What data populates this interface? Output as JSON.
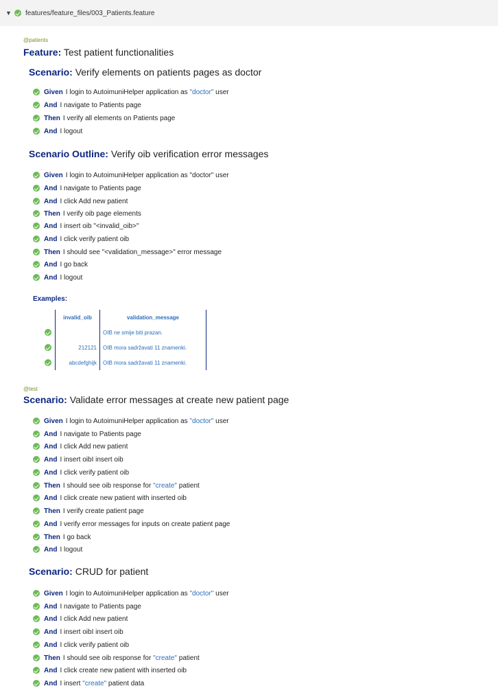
{
  "header": {
    "path": "features/feature_files/003_Patients.feature"
  },
  "feature": {
    "tag": "@patients",
    "keyword": "Feature:",
    "title": "Test patient functionalities"
  },
  "scenarios": [
    {
      "keyword": "Scenario:",
      "title": "Verify elements on patients pages as doctor",
      "steps": [
        {
          "kw": "Given",
          "pre": "I login to AutoimuniHelper application as ",
          "q": "\"doctor\"",
          "post": " user"
        },
        {
          "kw": "And",
          "pre": "I navigate to Patients page",
          "q": "",
          "post": ""
        },
        {
          "kw": "Then",
          "pre": "I verify all elements on Patients page",
          "q": "",
          "post": ""
        },
        {
          "kw": "And",
          "pre": "I logout",
          "q": "",
          "post": ""
        }
      ]
    },
    {
      "keyword": "Scenario Outline:",
      "title": "Verify oib verification error messages",
      "steps": [
        {
          "kw": "Given",
          "pre": "I login to AutoimuniHelper application as \"doctor\" user",
          "q": "",
          "post": ""
        },
        {
          "kw": "And",
          "pre": "I navigate to Patients page",
          "q": "",
          "post": ""
        },
        {
          "kw": "And",
          "pre": "I click Add new patient",
          "q": "",
          "post": ""
        },
        {
          "kw": "Then",
          "pre": "I verify oib page elements",
          "q": "",
          "post": ""
        },
        {
          "kw": "And",
          "pre": "I insert oib \"<invalid_oib>\"",
          "q": "",
          "post": ""
        },
        {
          "kw": "And",
          "pre": "I click verify patient oib",
          "q": "",
          "post": ""
        },
        {
          "kw": "Then",
          "pre": "I should see \"<validation_message>\" error message",
          "q": "",
          "post": ""
        },
        {
          "kw": "And",
          "pre": "I go back",
          "q": "",
          "post": ""
        },
        {
          "kw": "And",
          "pre": "I logout",
          "q": "",
          "post": ""
        }
      ],
      "examples": {
        "label": "Examples:",
        "headers": [
          "invalid_oib",
          "validation_message"
        ],
        "rows": [
          [
            "",
            "OIB ne smije biti prazan."
          ],
          [
            "212121",
            "OIB mora sadržavati 11 znamenki."
          ],
          [
            "abcdefghijk",
            "OIB mora sadržavati 11 znamenki."
          ]
        ]
      }
    },
    {
      "tag": "@test",
      "keyword": "Scenario:",
      "title": "Validate error messages at create new patient page",
      "steps": [
        {
          "kw": "Given",
          "pre": "I login to AutoimuniHelper application as ",
          "q": "\"doctor\"",
          "post": " user"
        },
        {
          "kw": "And",
          "pre": "I navigate to Patients page",
          "q": "",
          "post": ""
        },
        {
          "kw": "And",
          "pre": "I click Add new patient",
          "q": "",
          "post": ""
        },
        {
          "kw": "And",
          "pre": "I insert oibI insert oib",
          "q": "",
          "post": ""
        },
        {
          "kw": "And",
          "pre": "I click verify patient oib",
          "q": "",
          "post": ""
        },
        {
          "kw": "Then",
          "pre": "I should see oib response for ",
          "q": "\"create\"",
          "post": " patient"
        },
        {
          "kw": "And",
          "pre": "I click create new patient with inserted oib",
          "q": "",
          "post": ""
        },
        {
          "kw": "Then",
          "pre": "I verify create patient page",
          "q": "",
          "post": ""
        },
        {
          "kw": "And",
          "pre": "I verify error messages for inputs on create patient page",
          "q": "",
          "post": ""
        },
        {
          "kw": "Then",
          "pre": "I go back",
          "q": "",
          "post": ""
        },
        {
          "kw": "And",
          "pre": "I logout",
          "q": "",
          "post": ""
        }
      ]
    },
    {
      "keyword": "Scenario:",
      "title": "CRUD for patient",
      "steps": [
        {
          "kw": "Given",
          "pre": "I login to AutoimuniHelper application as ",
          "q": "\"doctor\"",
          "post": " user"
        },
        {
          "kw": "And",
          "pre": "I navigate to Patients page",
          "q": "",
          "post": ""
        },
        {
          "kw": "And",
          "pre": "I click Add new patient",
          "q": "",
          "post": ""
        },
        {
          "kw": "And",
          "pre": "I insert oibI insert oib",
          "q": "",
          "post": ""
        },
        {
          "kw": "And",
          "pre": "I click verify patient oib",
          "q": "",
          "post": ""
        },
        {
          "kw": "Then",
          "pre": "I should see oib response for ",
          "q": "\"create\"",
          "post": " patient"
        },
        {
          "kw": "And",
          "pre": "I click create new patient with inserted oib",
          "q": "",
          "post": ""
        },
        {
          "kw": "And",
          "pre": "I insert ",
          "q": "\"create\"",
          "post": " patient data"
        }
      ]
    }
  ]
}
